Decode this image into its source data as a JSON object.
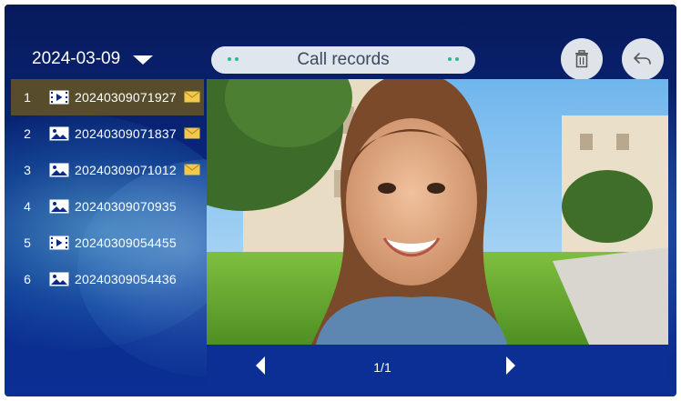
{
  "header": {
    "date": "2024-03-09",
    "title": "Call records"
  },
  "records": [
    {
      "index": "1",
      "type": "video-icon",
      "name": "20240309071927",
      "unread": true,
      "selected": true
    },
    {
      "index": "2",
      "type": "image-icon",
      "name": "20240309071837",
      "unread": true,
      "selected": false
    },
    {
      "index": "3",
      "type": "image-icon",
      "name": "20240309071012",
      "unread": true,
      "selected": false
    },
    {
      "index": "4",
      "type": "image-icon",
      "name": "20240309070935",
      "unread": false,
      "selected": false
    },
    {
      "index": "5",
      "type": "video-icon",
      "name": "20240309054455",
      "unread": false,
      "selected": false
    },
    {
      "index": "6",
      "type": "image-icon",
      "name": "20240309054436",
      "unread": false,
      "selected": false
    }
  ],
  "pagination": {
    "page_indicator": "1/1"
  },
  "colors": {
    "background": "#0a2a86",
    "selected_row": "#5c5028",
    "pill": "#dfe6ee",
    "accent_dots": "#22c08a",
    "mail": "#f2c94c"
  }
}
